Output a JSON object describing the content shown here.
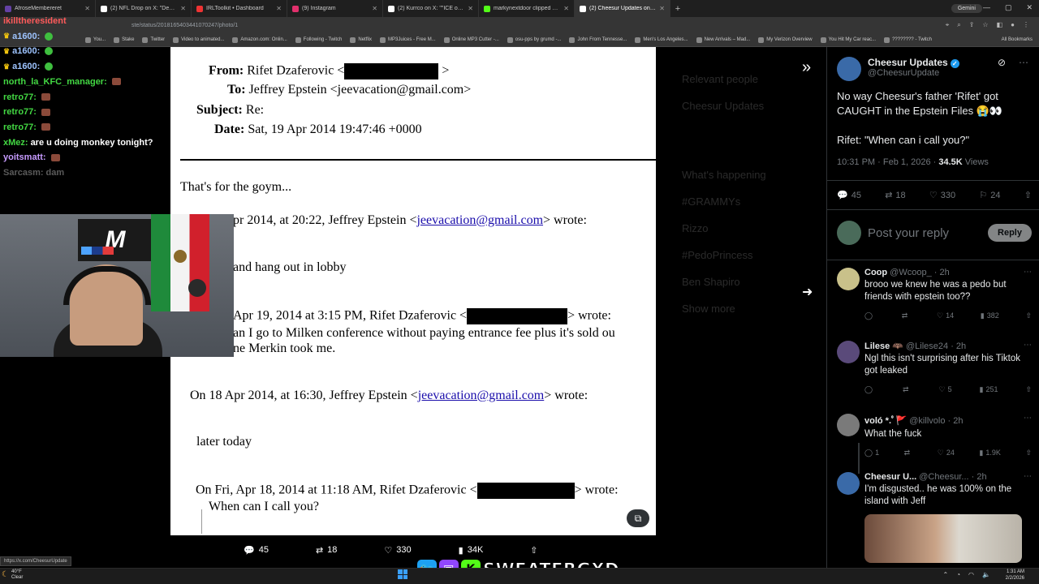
{
  "browser": {
    "tabs": [
      {
        "title": "AfroseMembereret",
        "color": "#6441a5"
      },
      {
        "title": "(2) NFL Drop on X: \"Despite sp",
        "color": "#ffffff"
      },
      {
        "title": "IRLToolkit • Dashboard",
        "color": "#e33"
      },
      {
        "title": "(9) Instagram",
        "color": "#e1306c"
      },
      {
        "title": "(2) Kurrco on X: \"\"ICE out. We'v",
        "color": "#ffffff"
      },
      {
        "title": "markynextdoor clipped by Ashr",
        "color": "#53fc18"
      },
      {
        "title": "(2) Cheesur Updates on X: \"No",
        "color": "#ffffff"
      }
    ],
    "gemini_label": "Gemini",
    "url": "ste/status/2018165403441070247/photo/1",
    "bookmarks": [
      "You...",
      "Stake",
      "Twitter",
      "Video to animated...",
      "Amazon.com: Onlin...",
      "Following - Twitch",
      "Netflix",
      "MP3Juices - Free M...",
      "Online MP3 Cutter -...",
      "osu-pps by grumd -...",
      "John From Tennesse...",
      "Men's Los Angeles...",
      "New Arrivals – Mad...",
      "My Verizon Overview",
      "You Hit My Car reac...",
      "???????? - Twitch"
    ],
    "all_bookmarks": "All Bookmarks"
  },
  "chat": [
    {
      "user": "ikilltheresident",
      "text": "",
      "color": "u-red"
    },
    {
      "user": "a1600:",
      "text": "",
      "color": "u-blue"
    },
    {
      "user": "a1600:",
      "text": "",
      "color": "u-blue"
    },
    {
      "user": "a1600:",
      "text": "",
      "color": "u-blue"
    },
    {
      "user": "north_la_KFC_manager:",
      "text": "",
      "color": "u-green"
    },
    {
      "user": "retro77:",
      "text": "",
      "color": "u-green"
    },
    {
      "user": "retro77:",
      "text": "",
      "color": "u-green"
    },
    {
      "user": "retro77:",
      "text": "",
      "color": "u-green"
    },
    {
      "user": "xMez:",
      "text": "are u doing monkey tonight?",
      "color": "u-green"
    },
    {
      "user": "yoitsmatt:",
      "text": "",
      "color": "u-purple"
    },
    {
      "user": "Sarcasm:",
      "text": "dam",
      "color": "u-white"
    }
  ],
  "email": {
    "from_label": "From:",
    "from_value": "Rifet Dzaferovic <",
    "to_label": "To:",
    "to_value": "Jeffrey Epstein <jeevacation@gmail.com>",
    "subject_label": "Subject:",
    "subject_value": "Re:",
    "date_label": "Date:",
    "date_value": "Sat, 19 Apr 2014 19:47:46 +0000",
    "body1": "That's for the goym...",
    "q1_pre": "pr 2014, at 20:22, Jeffrey Epstein <",
    "q1_link": "jeevacation@gmail.com",
    "q1_post": "> wrote:",
    "q1_body": "and hang out in lobby",
    "q2_pre": "Apr 19, 2014 at 3:15 PM, Rifet Dzaferovic <",
    "q2_post": "> wrote:",
    "q2_body1": "an I go to Milken conference without paying entrance fee plus it's sold ou",
    "q2_body2": "ne Merkin took me.",
    "q3_pre": "On 18 Apr 2014, at 16:30, Jeffrey Epstein <",
    "q3_link": "jeevacation@gmail.com",
    "q3_post": "> wrote:",
    "q3_body": "later today",
    "q4_pre": "On Fri, Apr 18, 2014 at 11:18 AM, Rifet Dzaferovic <",
    "q4_post": "> wrote:",
    "q4_body": "When can I call you?"
  },
  "photo_bar": {
    "replies": "45",
    "reposts": "18",
    "likes": "330",
    "views": "34K"
  },
  "dim_sidebar": [
    "Relevant people",
    "Cheesur Updates",
    "What's happening",
    "#GRAMMYs",
    "Rizzo",
    "#PedoPrincess",
    "Ben Shapiro",
    "Show more"
  ],
  "tweet": {
    "name": "Cheesur Updates",
    "handle": "@CheesurUpdate",
    "text1": "No way Cheesur's father 'Rifet' got CAUGHT in the Epstein Files 😭👀",
    "text2": "Rifet: \"When can i call you?\"",
    "time": "10:31 PM · Feb 1, 2026 · ",
    "views": "34.5K",
    "views_label": " Views",
    "replies": "45",
    "reposts": "18",
    "likes": "330",
    "bookmarks": "24",
    "reply_placeholder": "Post your reply",
    "reply_button": "Reply"
  },
  "replies": [
    {
      "name": "Coop",
      "handle": "@Wcoop_ · 2h",
      "text": "brooo we knew he was a pedo but friends with epstein too??",
      "r": "",
      "rt": "",
      "l": "14",
      "v": "382",
      "color": "#c9c18a"
    },
    {
      "name": "Lilese 🦇",
      "handle": "@Lilese24 · 2h",
      "text": "Ngl this isn't surprising after his Tiktok got leaked",
      "r": "",
      "rt": "",
      "l": "5",
      "v": "251",
      "color": "#5a4a7a"
    },
    {
      "name": "voló *.ﾟ🚩",
      "handle": "@killvolo · 2h",
      "text": "What the fuck",
      "r": "1",
      "rt": "",
      "l": "24",
      "v": "1.9K",
      "color": "#7a7a7a"
    },
    {
      "name": "Cheesur U...",
      "handle": "@Cheesur... · 2h",
      "text": "I'm disgusted.. he was 100% on the island with Jeff",
      "r": "",
      "rt": "",
      "l": "",
      "v": "",
      "color": "#3a6aa8"
    }
  ],
  "status_url": "https://x.com/CheesurUpdate",
  "stream_brand": "SWEATERGXD",
  "weather": {
    "temp": "40°F",
    "cond": "Clear"
  },
  "clock": {
    "time": "1:31 AM",
    "date": "2/2/2026"
  }
}
